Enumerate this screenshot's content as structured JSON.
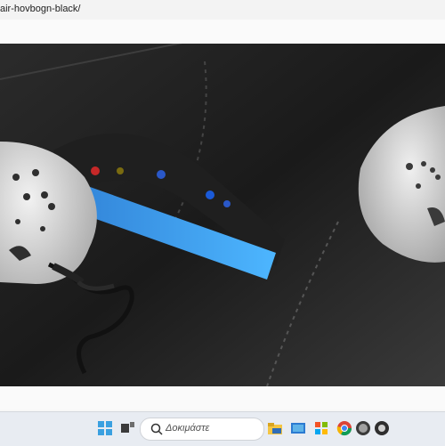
{
  "browser": {
    "url_fragment": "air-hovbogn-black/"
  },
  "taskbar": {
    "search_placeholder": "Δοκιμάστε"
  },
  "colors": {
    "taskbar_bg": "#e8ecf2",
    "window_bg": "#f7f7f7",
    "start_blue": "#3aa0e0"
  },
  "icons": {
    "start": "windows-start-icon",
    "task_view": "task-view-icon",
    "search": "search-icon",
    "apps": [
      "file-explorer-icon",
      "mail-icon",
      "store-icon",
      "chrome-icon",
      "edge-icon",
      "app-icon"
    ]
  }
}
